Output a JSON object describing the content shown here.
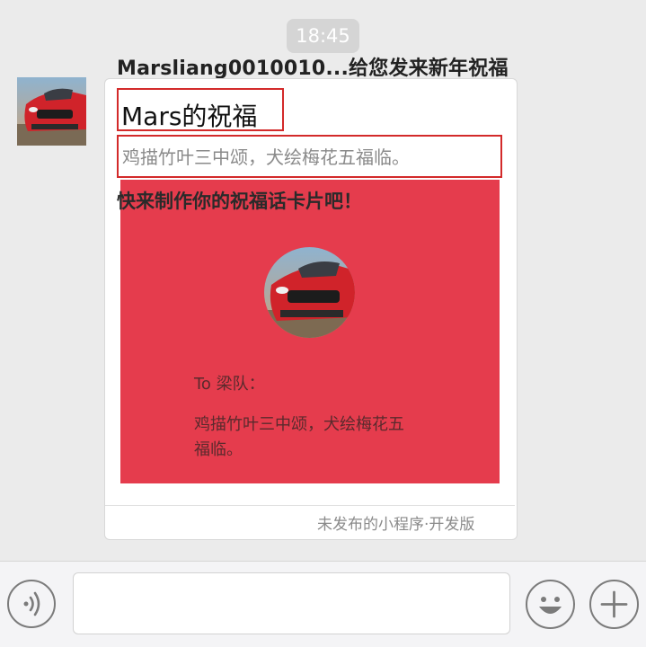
{
  "chat": {
    "time": "18:45",
    "sender_line": "Marsliang0010010...给您发来新年祝福"
  },
  "card": {
    "title": "Mars的祝福",
    "description": "鸡描竹叶三中颂，犬绘梅花五福临。",
    "overlay_text": "快来制作你的祝福话卡片吧！",
    "preview": {
      "to_line": "To 梁队：",
      "message_line1": "鸡描竹叶三中颂，犬绘梅花五",
      "message_line2": "福临。"
    },
    "footer": "未发布的小程序·开发版"
  },
  "colors": {
    "background": "#ebebeb",
    "card_preview": "#e53c4d",
    "highlight_box": "#d32a2a"
  },
  "icons": {
    "voice": "voice-icon",
    "emoji": "emoji-icon",
    "plus": "plus-icon"
  }
}
